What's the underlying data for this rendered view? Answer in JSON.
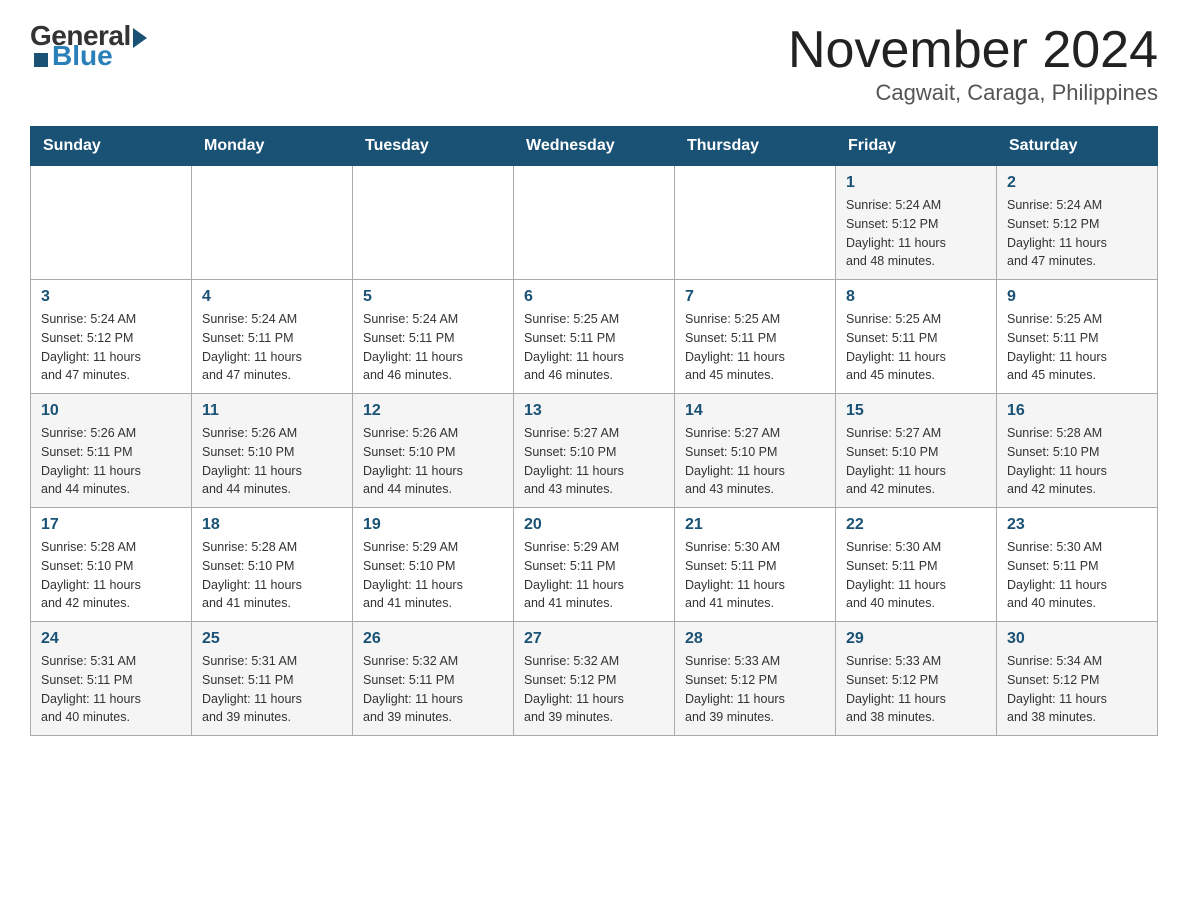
{
  "header": {
    "logo_general": "General",
    "logo_blue": "Blue",
    "month_title": "November 2024",
    "location": "Cagwait, Caraga, Philippines"
  },
  "days_of_week": [
    "Sunday",
    "Monday",
    "Tuesday",
    "Wednesday",
    "Thursday",
    "Friday",
    "Saturday"
  ],
  "weeks": [
    [
      {
        "day": "",
        "info": ""
      },
      {
        "day": "",
        "info": ""
      },
      {
        "day": "",
        "info": ""
      },
      {
        "day": "",
        "info": ""
      },
      {
        "day": "",
        "info": ""
      },
      {
        "day": "1",
        "info": "Sunrise: 5:24 AM\nSunset: 5:12 PM\nDaylight: 11 hours\nand 48 minutes."
      },
      {
        "day": "2",
        "info": "Sunrise: 5:24 AM\nSunset: 5:12 PM\nDaylight: 11 hours\nand 47 minutes."
      }
    ],
    [
      {
        "day": "3",
        "info": "Sunrise: 5:24 AM\nSunset: 5:12 PM\nDaylight: 11 hours\nand 47 minutes."
      },
      {
        "day": "4",
        "info": "Sunrise: 5:24 AM\nSunset: 5:11 PM\nDaylight: 11 hours\nand 47 minutes."
      },
      {
        "day": "5",
        "info": "Sunrise: 5:24 AM\nSunset: 5:11 PM\nDaylight: 11 hours\nand 46 minutes."
      },
      {
        "day": "6",
        "info": "Sunrise: 5:25 AM\nSunset: 5:11 PM\nDaylight: 11 hours\nand 46 minutes."
      },
      {
        "day": "7",
        "info": "Sunrise: 5:25 AM\nSunset: 5:11 PM\nDaylight: 11 hours\nand 45 minutes."
      },
      {
        "day": "8",
        "info": "Sunrise: 5:25 AM\nSunset: 5:11 PM\nDaylight: 11 hours\nand 45 minutes."
      },
      {
        "day": "9",
        "info": "Sunrise: 5:25 AM\nSunset: 5:11 PM\nDaylight: 11 hours\nand 45 minutes."
      }
    ],
    [
      {
        "day": "10",
        "info": "Sunrise: 5:26 AM\nSunset: 5:11 PM\nDaylight: 11 hours\nand 44 minutes."
      },
      {
        "day": "11",
        "info": "Sunrise: 5:26 AM\nSunset: 5:10 PM\nDaylight: 11 hours\nand 44 minutes."
      },
      {
        "day": "12",
        "info": "Sunrise: 5:26 AM\nSunset: 5:10 PM\nDaylight: 11 hours\nand 44 minutes."
      },
      {
        "day": "13",
        "info": "Sunrise: 5:27 AM\nSunset: 5:10 PM\nDaylight: 11 hours\nand 43 minutes."
      },
      {
        "day": "14",
        "info": "Sunrise: 5:27 AM\nSunset: 5:10 PM\nDaylight: 11 hours\nand 43 minutes."
      },
      {
        "day": "15",
        "info": "Sunrise: 5:27 AM\nSunset: 5:10 PM\nDaylight: 11 hours\nand 42 minutes."
      },
      {
        "day": "16",
        "info": "Sunrise: 5:28 AM\nSunset: 5:10 PM\nDaylight: 11 hours\nand 42 minutes."
      }
    ],
    [
      {
        "day": "17",
        "info": "Sunrise: 5:28 AM\nSunset: 5:10 PM\nDaylight: 11 hours\nand 42 minutes."
      },
      {
        "day": "18",
        "info": "Sunrise: 5:28 AM\nSunset: 5:10 PM\nDaylight: 11 hours\nand 41 minutes."
      },
      {
        "day": "19",
        "info": "Sunrise: 5:29 AM\nSunset: 5:10 PM\nDaylight: 11 hours\nand 41 minutes."
      },
      {
        "day": "20",
        "info": "Sunrise: 5:29 AM\nSunset: 5:11 PM\nDaylight: 11 hours\nand 41 minutes."
      },
      {
        "day": "21",
        "info": "Sunrise: 5:30 AM\nSunset: 5:11 PM\nDaylight: 11 hours\nand 41 minutes."
      },
      {
        "day": "22",
        "info": "Sunrise: 5:30 AM\nSunset: 5:11 PM\nDaylight: 11 hours\nand 40 minutes."
      },
      {
        "day": "23",
        "info": "Sunrise: 5:30 AM\nSunset: 5:11 PM\nDaylight: 11 hours\nand 40 minutes."
      }
    ],
    [
      {
        "day": "24",
        "info": "Sunrise: 5:31 AM\nSunset: 5:11 PM\nDaylight: 11 hours\nand 40 minutes."
      },
      {
        "day": "25",
        "info": "Sunrise: 5:31 AM\nSunset: 5:11 PM\nDaylight: 11 hours\nand 39 minutes."
      },
      {
        "day": "26",
        "info": "Sunrise: 5:32 AM\nSunset: 5:11 PM\nDaylight: 11 hours\nand 39 minutes."
      },
      {
        "day": "27",
        "info": "Sunrise: 5:32 AM\nSunset: 5:12 PM\nDaylight: 11 hours\nand 39 minutes."
      },
      {
        "day": "28",
        "info": "Sunrise: 5:33 AM\nSunset: 5:12 PM\nDaylight: 11 hours\nand 39 minutes."
      },
      {
        "day": "29",
        "info": "Sunrise: 5:33 AM\nSunset: 5:12 PM\nDaylight: 11 hours\nand 38 minutes."
      },
      {
        "day": "30",
        "info": "Sunrise: 5:34 AM\nSunset: 5:12 PM\nDaylight: 11 hours\nand 38 minutes."
      }
    ]
  ]
}
